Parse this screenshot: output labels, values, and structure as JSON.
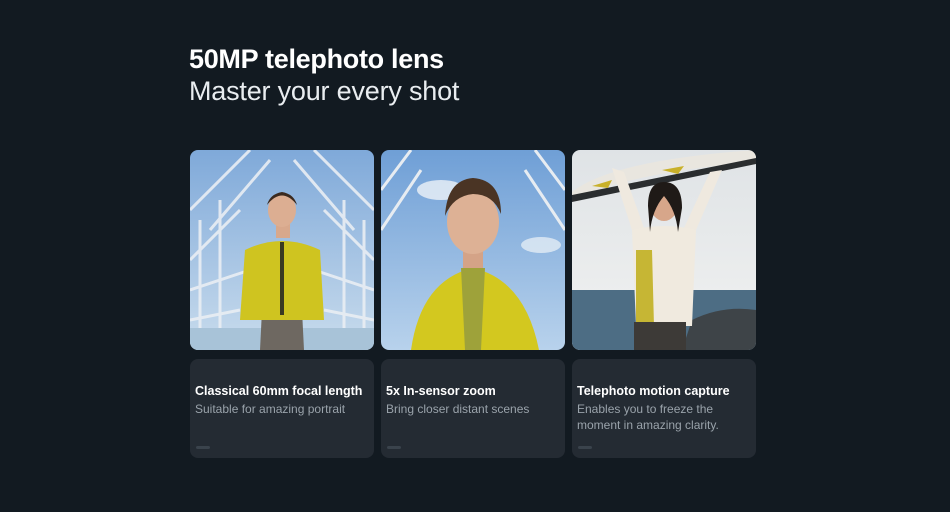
{
  "hero": {
    "title": "50MP telephoto lens",
    "subtitle": "Master your every shot"
  },
  "features": [
    {
      "title": "Classical 60mm focal length",
      "description": "Suitable for amazing portrait"
    },
    {
      "title": "5x In-sensor zoom",
      "description": "Bring closer distant scenes"
    },
    {
      "title": "Telephoto motion capture",
      "description": "Enables you to freeze the moment in amazing clarity."
    }
  ],
  "colors": {
    "background": "#121a21",
    "card": "#242b33",
    "jacket": "#d6cb1c",
    "sky": "#8fb6de"
  }
}
